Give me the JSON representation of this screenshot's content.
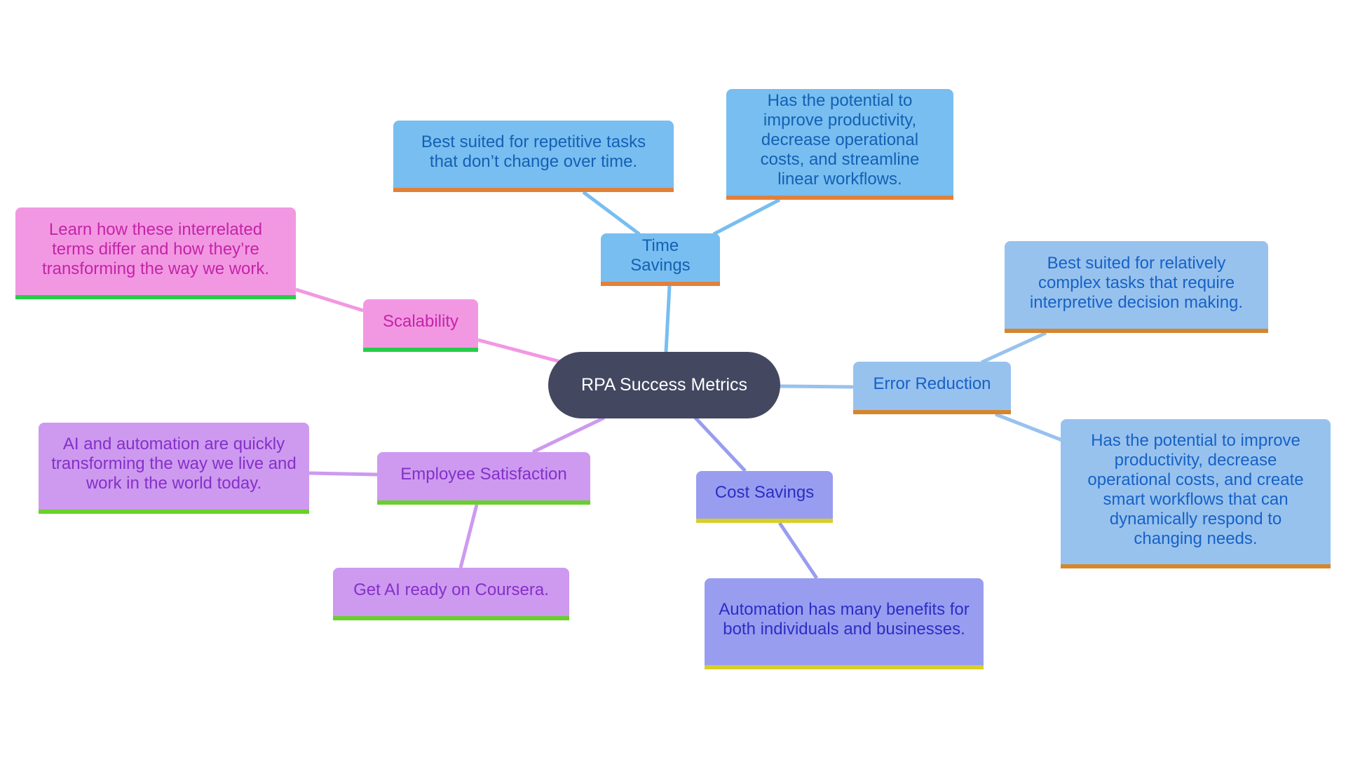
{
  "root": {
    "label": "RPA Success Metrics",
    "color": "#434760"
  },
  "branches": [
    {
      "id": "time-savings",
      "label": "Time Savings",
      "colors": {
        "fill": "#78bef0",
        "text": "#1460b4",
        "accent": "#e2803a",
        "edge": "#78bef0"
      },
      "children": [
        "Best suited for repetitive tasks that don’t change over time.",
        "Has the potential to improve productivity, decrease operational costs, and streamline linear workflows."
      ]
    },
    {
      "id": "error-reduction",
      "label": "Error Reduction",
      "colors": {
        "fill": "#98c2ee",
        "text": "#1662c6",
        "accent": "#d6862c",
        "edge": "#98c2ee"
      },
      "children": [
        "Best suited for relatively complex tasks that require interpretive decision making.",
        "Has the potential to improve productivity, decrease operational costs, and create smart workflows that can dynamically respond to changing needs."
      ]
    },
    {
      "id": "cost-savings",
      "label": "Cost Savings",
      "colors": {
        "fill": "#999df0",
        "text": "#2b2ec3",
        "accent": "#d8cf28",
        "edge": "#999df0"
      },
      "children": [
        "Automation has many benefits for both individuals and businesses."
      ]
    },
    {
      "id": "employee-satisfaction",
      "label": "Employee Satisfaction",
      "colors": {
        "fill": "#cd9af0",
        "text": "#8530c8",
        "accent": "#68d02a",
        "edge": "#cd9af0"
      },
      "children": [
        "AI and automation are quickly transforming the way we live and work in the world today.",
        "Get AI ready on Coursera."
      ]
    },
    {
      "id": "scalability",
      "label": "Scalability",
      "colors": {
        "fill": "#f298e2",
        "text": "#c424a8",
        "accent": "#28cc48",
        "edge": "#f298e2"
      },
      "children": [
        "Learn how these interrelated terms differ and how they’re transforming the way we work."
      ]
    }
  ]
}
